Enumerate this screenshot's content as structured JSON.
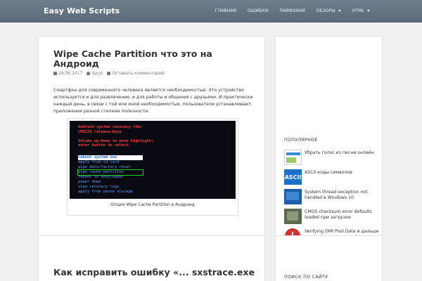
{
  "navbar": {
    "brand": "Easy Web Scripts",
    "items": [
      {
        "label": "ГЛАВНАЯ"
      },
      {
        "label": "ОШИБКИ"
      },
      {
        "label": "ЛАЙФХАКИ"
      },
      {
        "label": "ОБЗОРЫ",
        "has_dropdown": true
      },
      {
        "label": "HTML",
        "has_dropdown": true
      }
    ]
  },
  "post1": {
    "title": "Wipe Cache Partition что это на Андроид",
    "date": "29.06.2017",
    "author": "Spryt",
    "comment_link": "Оставить комментарий",
    "text": "Смартфон для современного человека является необходимостью. Это устройство используется и для развлечения, и для работы и общения с друзьями. И практически каждый день, в связи с той или иной необходимостью, пользователи устанавливают приложения разной степени полезности.",
    "figure": {
      "header_lines": [
        "Android system recovery <3e>",
        "LMX22G release-keys",
        "",
        "Volume up/down to move highlight;",
        "enter button to select."
      ],
      "menu": [
        "reboot system now",
        "apply from sd card",
        "wipe data/factory reset",
        "wipe cache partition",
        "reboot to bootloader",
        "power down",
        "view recovery logs",
        "apply from phone storage"
      ],
      "caption": "Опция Wipe Cache Partition в Андроид"
    }
  },
  "post2": {
    "title": "Как исправить ошибку «... sxstrace.exe"
  },
  "sidebar": {
    "popular_heading": "ПОПУЛЯРНОЕ",
    "popular": [
      {
        "text": "Убрать голос из песни онлайн",
        "icon": "audio-editor-thumb"
      },
      {
        "text": "ASCII-коды символов",
        "icon": "ascii-thumb",
        "thumb_label": "ASCII"
      },
      {
        "text": "System thread exception not handled в Windows 10",
        "icon": "windows-thumb"
      },
      {
        "text": "CMOS checksum error defaults loaded при загрузке",
        "icon": "motherboard-thumb"
      },
      {
        "text": "Verifying DMI Pool Data и дальше не грузит, что делать?",
        "icon": "error-thumb"
      }
    ],
    "search_heading": "ПОИСК ПО САЙТУ"
  }
}
